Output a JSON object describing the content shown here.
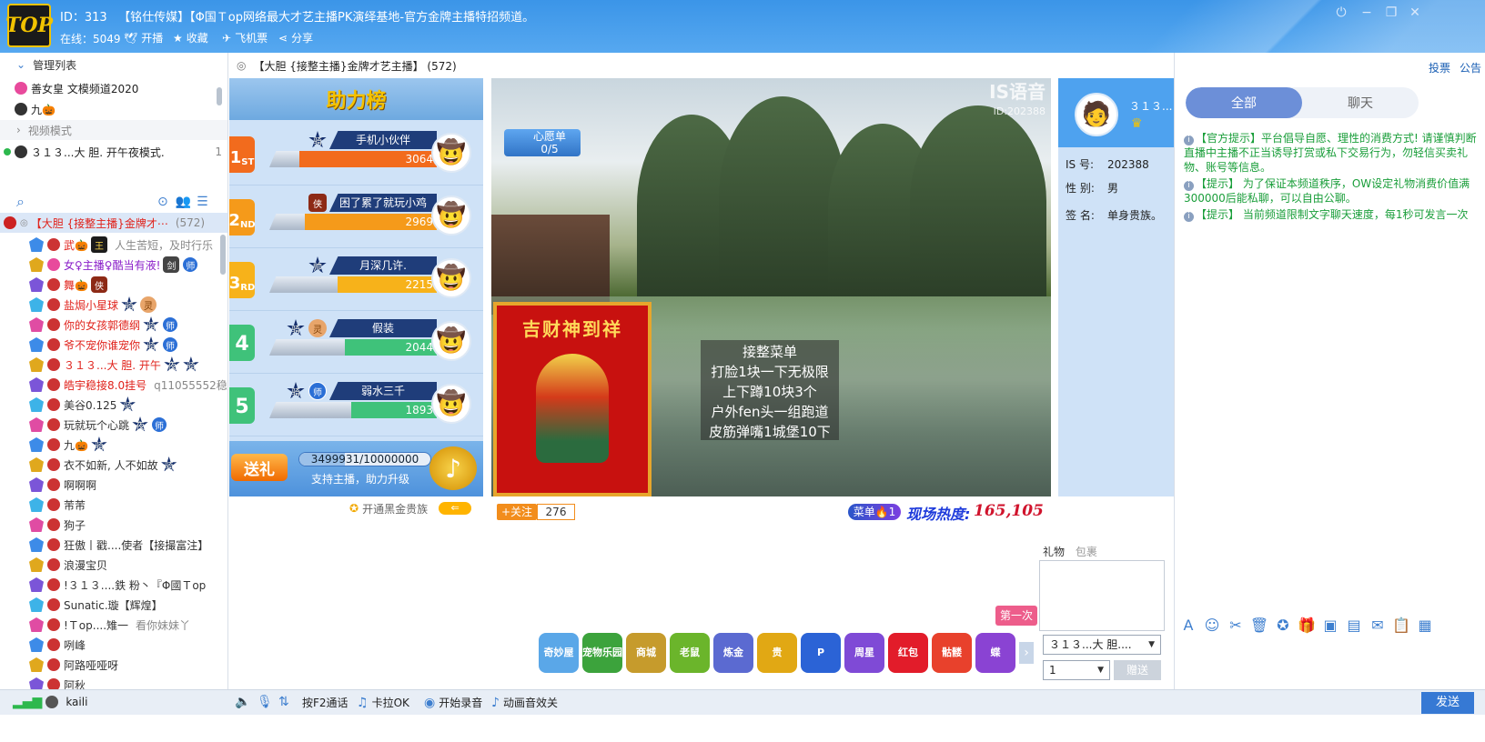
{
  "header": {
    "id_label": "ID：313",
    "room_title": "【铭仕传媒】【Φ国Ｔop网络最大才艺主播PK演绎基地-官方金牌主播特招频道。",
    "online": "在线：5049",
    "btn_broadcast": "开播",
    "btn_favorite": "收藏",
    "btn_ticket": "飞机票",
    "btn_share": "分享"
  },
  "left": {
    "manage_title": "管理列表",
    "managers": [
      {
        "name": "善女皇 文模频道2020"
      },
      {
        "name": "九🎃"
      }
    ],
    "video_mode": "视频模式",
    "video_user": {
      "name": "３１３...大 胆. 开午夜模式.",
      "count": "1"
    },
    "channel": {
      "name": "【大胆 {接整主播}金牌才⋯",
      "count": "(572)"
    },
    "users": [
      {
        "name": "武🎃",
        "note": "人生苦短，及时行乐",
        "badges": [
          "王"
        ],
        "color": "red"
      },
      {
        "name": "女♀主播♀酷当有液!",
        "note": "",
        "badges": [
          "剑",
          "师"
        ],
        "color": "purple"
      },
      {
        "name": "舞🎃",
        "note": "",
        "badges": [
          "侠"
        ],
        "color": "red"
      },
      {
        "name": "盐焗小星球",
        "note": "",
        "badges": [
          "骑",
          "灵"
        ],
        "color": "red"
      },
      {
        "name": "你的女孩郭德纲",
        "note": "",
        "badges": [
          "骑",
          "师"
        ],
        "color": "red"
      },
      {
        "name": "爷不宠你谁宠你",
        "note": "",
        "badges": [
          "骑",
          "师"
        ],
        "color": "red"
      },
      {
        "name": "３１３...大 胆. 开午",
        "note": "",
        "badges": [
          "夜",
          "骑"
        ],
        "color": "red"
      },
      {
        "name": "皓宇稳接8.0挂号",
        "note": "q11055552稳5",
        "badges": [],
        "color": "red"
      },
      {
        "name": "美谷0.125",
        "note": "",
        "badges": [
          "骑"
        ],
        "color": "dark"
      },
      {
        "name": "玩就玩个心跳",
        "note": "",
        "badges": [
          "夜",
          "师"
        ],
        "color": "dark"
      },
      {
        "name": "九🎃",
        "note": "",
        "badges": [
          "骑"
        ],
        "color": "dark"
      },
      {
        "name": "衣不如新, 人不如故",
        "note": "",
        "badges": [
          "骑"
        ],
        "color": "dark"
      },
      {
        "name": "啊啊啊",
        "note": "",
        "badges": [],
        "color": "dark"
      },
      {
        "name": "芾芾",
        "note": "",
        "badges": [],
        "color": "dark"
      },
      {
        "name": "狗子",
        "note": "",
        "badges": [],
        "color": "dark"
      },
      {
        "name": "狂傲丨戳....使者【接撮富注】",
        "note": "",
        "badges": [],
        "color": "dark"
      },
      {
        "name": "浪漫宝贝",
        "note": "",
        "badges": [],
        "color": "dark"
      },
      {
        "name": "!３１３....鉄  粉丶『Φ國Ｔop",
        "note": "",
        "badges": [],
        "color": "dark"
      },
      {
        "name": "Sunatic.璇【辉煌】",
        "note": "",
        "badges": [],
        "color": "dark"
      },
      {
        "name": "!Ｔop....雉一",
        "note": "看你妹妹丫",
        "badges": [],
        "color": "dark"
      },
      {
        "name": "咧峰",
        "note": "",
        "badges": [],
        "color": "dark"
      },
      {
        "name": "阿路哑哑呀",
        "note": "",
        "badges": [],
        "color": "dark"
      },
      {
        "name": "阿秋",
        "note": "",
        "badges": [],
        "color": "dark"
      }
    ]
  },
  "center": {
    "room_header": "【大胆 {接整主播}金牌才艺主播】 (572)",
    "rank_title": "助力榜",
    "ranks": [
      {
        "no": "1",
        "suffix": "ST",
        "name": "手机小伙伴",
        "value": "3064",
        "badges": [
          "骑"
        ],
        "color": "#f26b1d",
        "fill": 0.82
      },
      {
        "no": "2",
        "suffix": "ND",
        "name": "困了累了就玩小鸡",
        "value": "2969",
        "badges": [
          "侠"
        ],
        "color": "#f59a1a",
        "fill": 0.79
      },
      {
        "no": "3",
        "suffix": "RD",
        "name": "月深几许.",
        "value": "2215",
        "badges": [
          "帅"
        ],
        "color": "#f7b21a",
        "fill": 0.59
      },
      {
        "no": "4",
        "suffix": "",
        "name": "假装",
        "value": "2044",
        "badges": [
          "骑",
          "灵"
        ],
        "color": "#3fc27a",
        "fill": 0.55
      },
      {
        "no": "5",
        "suffix": "",
        "name": "弱水三千",
        "value": "1893",
        "badges": [
          "骑",
          "师"
        ],
        "color": "#3fc27a",
        "fill": 0.51
      }
    ],
    "support_btn": "送礼",
    "support_progress": "3499931/10000000",
    "support_progress_fraction": 0.35,
    "support_label": "支持主播，助力升级",
    "blackgold": "开通黑金贵族",
    "wish_label": "心愿单",
    "wish_count": "0/5",
    "watermark": "IS语音",
    "watermark_id": "ID:202388",
    "poster_title": "吉财神到祥",
    "menu_lines": [
      "接整菜单",
      "打脸1块一下无极限",
      "上下蹲10块3个",
      "户外fen头一组跑道",
      "皮筋弹嘴1城堡10下"
    ],
    "follow_label": "+关注",
    "follow_count": "276",
    "menu_btn": "菜单🔥1",
    "heat_label": "现场热度:",
    "heat_value": "165,105"
  },
  "anchor": {
    "name": "３１３...",
    "is_label": "IS  号:",
    "is_value": "202388",
    "gender_label": "性  别:",
    "gender_value": "男",
    "sign_label": "签  名:",
    "sign_value": "单身贵族。"
  },
  "gifts": {
    "tab_gift": "礼物",
    "tab_bag": "包裹",
    "target": "３１３...大 胆....",
    "qty": "1",
    "send": "赠送",
    "first_badge": "第一次",
    "icons": [
      {
        "label": "奇妙屋",
        "color": "#5aa7e8"
      },
      {
        "label": "宠物乐园",
        "color": "#3ca33c"
      },
      {
        "label": "商城",
        "color": "#c69b2c"
      },
      {
        "label": "老鼠",
        "color": "#6bb52b"
      },
      {
        "label": "炼金",
        "color": "#5b6ad1"
      },
      {
        "label": "贵",
        "color": "#e1a814"
      },
      {
        "label": "P",
        "color": "#2b63d6"
      },
      {
        "label": "周星",
        "color": "#7f4ad6"
      },
      {
        "label": "红包",
        "color": "#e21c2a"
      },
      {
        "label": "骷髅",
        "color": "#e8412c"
      },
      {
        "label": "蝶",
        "color": "#8a43d3"
      }
    ]
  },
  "right": {
    "link_report": "投票",
    "link_notice": "公告",
    "tab_all": "全部",
    "tab_chat": "聊天",
    "messages": [
      "【官方提示】平台倡导自愿、理性的消费方式! 请谨慎判断直播中主播不正当诱导打赏或私下交易行为，勿轻信买卖礼物、账号等信息。",
      "【提示】 为了保证本频道秩序，OW设定礼物消费价值满300000后能私聊，可以自由公聊。",
      "【提示】 当前频道限制文字聊天速度，每1秒可发言一次"
    ]
  },
  "bottom": {
    "user": "kaili",
    "f2_talk": "按F2通话",
    "karaoke": "卡拉OK",
    "record": "开始录音",
    "sfx": "动画音效关",
    "send": "发送"
  }
}
